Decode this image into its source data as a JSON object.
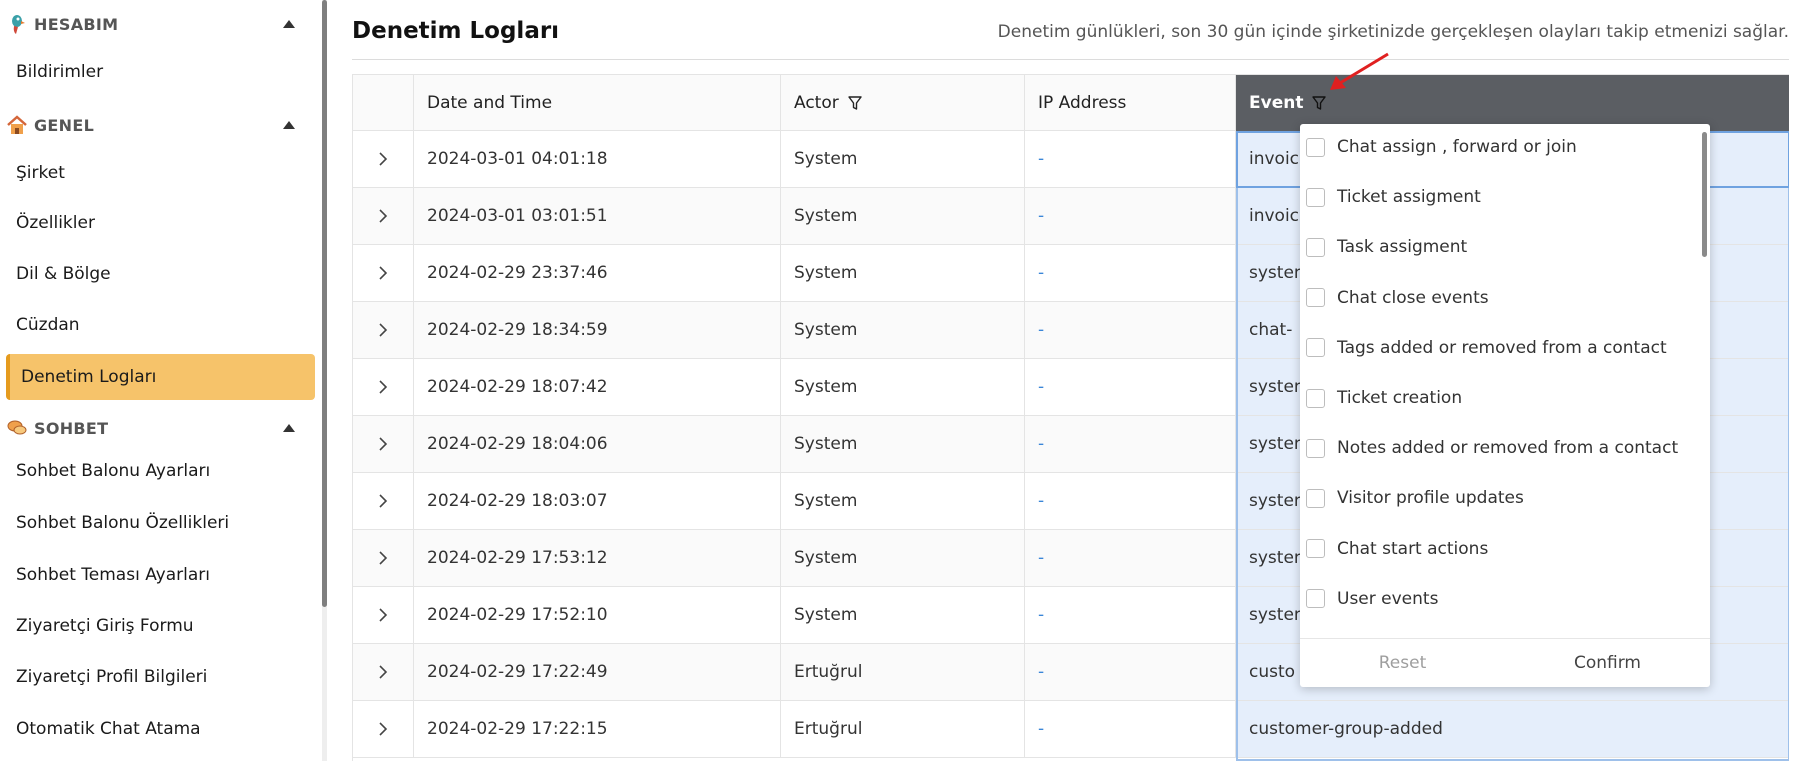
{
  "sidebar": {
    "sections": [
      {
        "title": "HESABIM",
        "icon": "parrot-icon"
      },
      {
        "title": "GENEL",
        "icon": "home-icon"
      },
      {
        "title": "SOHBET",
        "icon": "chat-bubbles-icon"
      }
    ],
    "hesabim_items": [
      "Bildirimler"
    ],
    "genel_items": [
      "Şirket",
      "Özellikler",
      "Dil & Bölge",
      "Cüzdan",
      "Denetim Logları"
    ],
    "sohbet_items": [
      "Sohbet Balonu Ayarları",
      "Sohbet Balonu Özellikleri",
      "Sohbet Teması Ayarları",
      "Ziyaretçi Giriş Formu",
      "Ziyaretçi Profil Bilgileri",
      "Otomatik Chat Atama"
    ],
    "active_item": "Denetim Logları"
  },
  "page": {
    "title": "Denetim Logları",
    "description": "Denetim günlükleri, son 30 gün içinde şirketinizde gerçekleşen olayları takip etmenizi sağlar."
  },
  "table": {
    "columns": [
      "Date and Time",
      "Actor",
      "IP Address",
      "Event"
    ],
    "rows": [
      {
        "datetime": "2024-03-01 04:01:18",
        "actor": "System",
        "ip": "-",
        "event": "invoic"
      },
      {
        "datetime": "2024-03-01 03:01:51",
        "actor": "System",
        "ip": "-",
        "event": "invoic"
      },
      {
        "datetime": "2024-02-29 23:37:46",
        "actor": "System",
        "ip": "-",
        "event": "systen"
      },
      {
        "datetime": "2024-02-29 18:34:59",
        "actor": "System",
        "ip": "-",
        "event": "chat-"
      },
      {
        "datetime": "2024-02-29 18:07:42",
        "actor": "System",
        "ip": "-",
        "event": "systen"
      },
      {
        "datetime": "2024-02-29 18:04:06",
        "actor": "System",
        "ip": "-",
        "event": "systen"
      },
      {
        "datetime": "2024-02-29 18:03:07",
        "actor": "System",
        "ip": "-",
        "event": "systen"
      },
      {
        "datetime": "2024-02-29 17:53:12",
        "actor": "System",
        "ip": "-",
        "event": "systen"
      },
      {
        "datetime": "2024-02-29 17:52:10",
        "actor": "System",
        "ip": "-",
        "event": "systen"
      },
      {
        "datetime": "2024-02-29 17:22:49",
        "actor": "Ertuğrul",
        "ip": "-",
        "event": "custo"
      },
      {
        "datetime": "2024-02-29 17:22:15",
        "actor": "Ertuğrul",
        "ip": "-",
        "event": "customer-group-added"
      }
    ]
  },
  "event_filter": {
    "options": [
      "Chat assign , forward or join",
      "Ticket assigment",
      "Task assigment",
      "Chat close events",
      "Tags added or removed from a contact",
      "Ticket creation",
      "Notes added or removed from a contact",
      "Visitor profile updates",
      "Chat start actions",
      "User events"
    ],
    "reset_label": "Reset",
    "confirm_label": "Confirm"
  },
  "colors": {
    "active_item_bg": "#f6c36a",
    "event_header_bg": "#5b5e63",
    "ip_link": "#3a86d8",
    "annotation_arrow": "#e02020"
  }
}
